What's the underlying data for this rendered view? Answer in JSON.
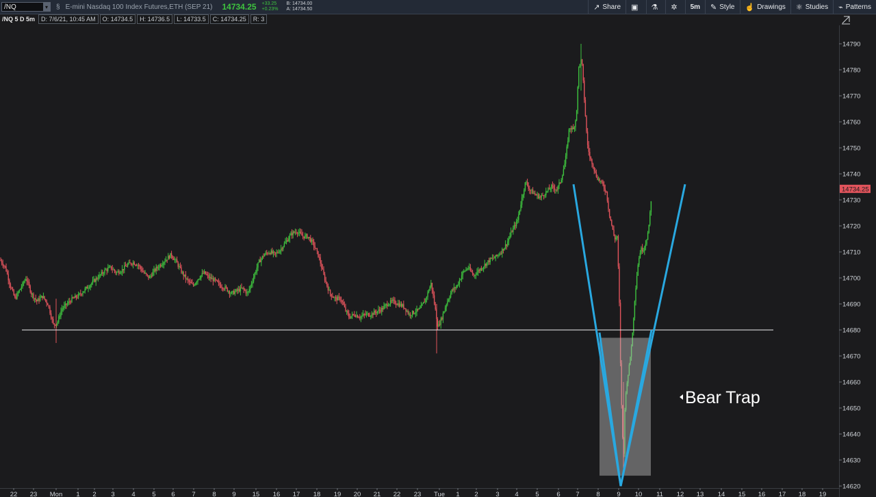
{
  "toolbar": {
    "symbol": "/NQ",
    "description": "E-mini Nasdaq 100 Index Futures,ETH (SEP 21)",
    "last_price": "14734.25",
    "change": "+33.25",
    "change_pct": "+0.23%",
    "bid": "B: 14734.00",
    "ask": "A: 14734.50",
    "buttons": {
      "share": "Share",
      "timeframe": "5m",
      "style": "Style",
      "drawings": "Drawings",
      "studies": "Studies",
      "patterns": "Patterns"
    }
  },
  "infobar": {
    "symbol": "/NQ 5 D 5m",
    "date": "D: 7/6/21, 10:45 AM",
    "open": "O: 14734.5",
    "high": "H: 14736.5",
    "low": "L: 14733.5",
    "close": "C: 14734.25",
    "range": "R: 3"
  },
  "chart_data": {
    "type": "candlestick",
    "title": "",
    "ylim": [
      14618,
      14798
    ],
    "grid": false,
    "y_ticks": [
      14790,
      14780,
      14770,
      14760,
      14750,
      14740,
      14730,
      14720,
      14710,
      14700,
      14690,
      14680,
      14670,
      14660,
      14650,
      14640,
      14630,
      14620
    ],
    "x_ticks": [
      "22",
      "23",
      "Mon",
      "1",
      "2",
      "3",
      "4",
      "5",
      "6",
      "7",
      "8",
      "9",
      "15",
      "16",
      "17",
      "18",
      "19",
      "20",
      "21",
      "22",
      "23",
      "Tue",
      "1",
      "2",
      "3",
      "4",
      "5",
      "6",
      "7",
      "8",
      "9",
      "10",
      "11",
      "12",
      "13",
      "14",
      "15",
      "16",
      "17",
      "18",
      "19"
    ],
    "current_price_label": "14734.25",
    "up_color": "#3ec33e",
    "down_color": "#e2545c",
    "close_path": [
      [
        0,
        14707
      ],
      [
        8,
        14704
      ],
      [
        15,
        14697
      ],
      [
        22,
        14692
      ],
      [
        30,
        14696
      ],
      [
        38,
        14700
      ],
      [
        46,
        14694
      ],
      [
        54,
        14691
      ],
      [
        62,
        14693
      ],
      [
        70,
        14690
      ],
      [
        78,
        14682
      ],
      [
        84,
        14683
      ],
      [
        90,
        14688
      ],
      [
        98,
        14690
      ],
      [
        106,
        14692
      ],
      [
        114,
        14693
      ],
      [
        122,
        14695
      ],
      [
        130,
        14697
      ],
      [
        138,
        14699
      ],
      [
        146,
        14701
      ],
      [
        154,
        14703
      ],
      [
        162,
        14704
      ],
      [
        170,
        14702
      ],
      [
        178,
        14703
      ],
      [
        186,
        14705
      ],
      [
        194,
        14706
      ],
      [
        202,
        14705
      ],
      [
        210,
        14702
      ],
      [
        218,
        14700
      ],
      [
        226,
        14703
      ],
      [
        234,
        14705
      ],
      [
        242,
        14707
      ],
      [
        250,
        14709
      ],
      [
        258,
        14706
      ],
      [
        266,
        14702
      ],
      [
        274,
        14699
      ],
      [
        282,
        14697
      ],
      [
        290,
        14700
      ],
      [
        298,
        14702
      ],
      [
        306,
        14700
      ],
      [
        314,
        14699
      ],
      [
        322,
        14697
      ],
      [
        330,
        14696
      ],
      [
        338,
        14694
      ],
      [
        346,
        14695
      ],
      [
        354,
        14696
      ],
      [
        362,
        14694
      ],
      [
        370,
        14700
      ],
      [
        378,
        14706
      ],
      [
        386,
        14709
      ],
      [
        394,
        14710
      ],
      [
        402,
        14709
      ],
      [
        410,
        14711
      ],
      [
        418,
        14714
      ],
      [
        426,
        14717
      ],
      [
        434,
        14718
      ],
      [
        442,
        14716
      ],
      [
        450,
        14716
      ],
      [
        458,
        14713
      ],
      [
        466,
        14708
      ],
      [
        474,
        14700
      ],
      [
        482,
        14694
      ],
      [
        490,
        14692
      ],
      [
        498,
        14692
      ],
      [
        504,
        14688
      ],
      [
        510,
        14685
      ],
      [
        518,
        14686
      ],
      [
        526,
        14685
      ],
      [
        534,
        14686
      ],
      [
        542,
        14686
      ],
      [
        550,
        14687
      ],
      [
        558,
        14688
      ],
      [
        566,
        14690
      ],
      [
        574,
        14691
      ],
      [
        582,
        14690
      ],
      [
        590,
        14689
      ],
      [
        598,
        14686
      ],
      [
        606,
        14687
      ],
      [
        614,
        14688
      ],
      [
        622,
        14692
      ],
      [
        630,
        14698
      ],
      [
        636,
        14688
      ],
      [
        640,
        14681
      ],
      [
        646,
        14685
      ],
      [
        652,
        14690
      ],
      [
        660,
        14695
      ],
      [
        668,
        14697
      ],
      [
        676,
        14702
      ],
      [
        684,
        14704
      ],
      [
        692,
        14701
      ],
      [
        700,
        14703
      ],
      [
        708,
        14705
      ],
      [
        716,
        14707
      ],
      [
        724,
        14708
      ],
      [
        732,
        14710
      ],
      [
        740,
        14713
      ],
      [
        748,
        14718
      ],
      [
        756,
        14722
      ],
      [
        762,
        14730
      ],
      [
        768,
        14737
      ],
      [
        774,
        14734
      ],
      [
        782,
        14732
      ],
      [
        790,
        14731
      ],
      [
        798,
        14733
      ],
      [
        806,
        14735
      ],
      [
        814,
        14734
      ],
      [
        820,
        14738
      ],
      [
        826,
        14745
      ],
      [
        832,
        14758
      ],
      [
        838,
        14757
      ],
      [
        842,
        14762
      ],
      [
        846,
        14782
      ],
      [
        850,
        14784
      ],
      [
        854,
        14768
      ],
      [
        858,
        14752
      ],
      [
        862,
        14746
      ],
      [
        866,
        14744
      ],
      [
        870,
        14740
      ],
      [
        874,
        14738
      ],
      [
        878,
        14737
      ],
      [
        882,
        14735
      ],
      [
        886,
        14733
      ],
      [
        890,
        14725
      ],
      [
        894,
        14720
      ],
      [
        898,
        14715
      ],
      [
        902,
        14716
      ],
      [
        905,
        14690
      ],
      [
        907,
        14661
      ],
      [
        909,
        14645
      ],
      [
        911,
        14628
      ],
      [
        913,
        14650
      ],
      [
        916,
        14660
      ],
      [
        920,
        14667
      ],
      [
        924,
        14678
      ],
      [
        928,
        14694
      ],
      [
        932,
        14705
      ],
      [
        936,
        14711
      ],
      [
        940,
        14711
      ],
      [
        944,
        14714
      ],
      [
        948,
        14719
      ],
      [
        951,
        14729
      ],
      [
        953,
        14734
      ]
    ],
    "annotations": {
      "support_level": 14680,
      "support_x_range": [
        32,
        1130
      ],
      "trap_box": {
        "x_range": [
          876,
          951
        ],
        "y_range": [
          14624,
          14677
        ]
      },
      "v_lines": [
        [
          [
            838,
            14736
          ],
          [
            907,
            14620
          ],
          [
            1001,
            14736
          ]
        ],
        [
          [
            907,
            14620
          ],
          [
            952,
            14680
          ]
        ],
        [
          [
            876,
            14679
          ],
          [
            907,
            14620
          ]
        ]
      ],
      "v_color": "#29a8e0",
      "label": "Bear Trap"
    }
  }
}
